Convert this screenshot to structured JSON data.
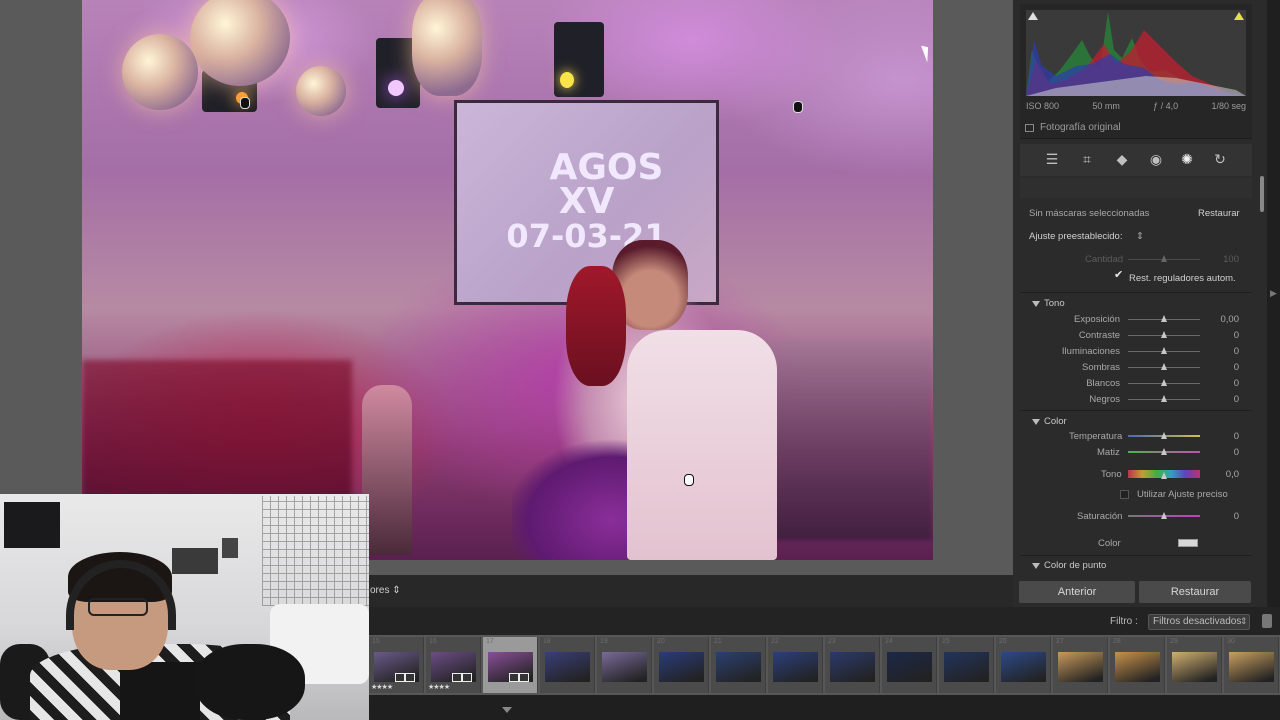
{
  "photo": {
    "projection_lines": [
      "AGOS",
      "XV",
      "07-03-21"
    ]
  },
  "toolbar": {
    "sort_label": "ores ⇕"
  },
  "filmstrip": {
    "filter_label": "Filtro :",
    "filter_value": "Filtros desactivados",
    "cells": [
      {
        "num": "15",
        "stars": "★★★★",
        "thumb": "#6a5a8a",
        "badge": true,
        "selected": false
      },
      {
        "num": "16",
        "stars": "★★★★",
        "thumb": "#6c4d86",
        "badge": true,
        "selected": false
      },
      {
        "num": "17",
        "stars": "",
        "thumb": "#8a4f98",
        "badge": true,
        "selected": true
      },
      {
        "num": "18",
        "stars": "",
        "thumb": "#3a3f78",
        "badge": false,
        "selected": false
      },
      {
        "num": "19",
        "stars": "",
        "thumb": "#7a6a9a",
        "badge": false,
        "selected": false
      },
      {
        "num": "20",
        "stars": "",
        "thumb": "#2a3c7a",
        "badge": false,
        "selected": false
      },
      {
        "num": "21",
        "stars": "",
        "thumb": "#2b4070",
        "badge": false,
        "selected": false
      },
      {
        "num": "22",
        "stars": "",
        "thumb": "#2c3f7c",
        "badge": false,
        "selected": false
      },
      {
        "num": "23",
        "stars": "",
        "thumb": "#2d3a6b",
        "badge": false,
        "selected": false
      },
      {
        "num": "24",
        "stars": "",
        "thumb": "#1d2848",
        "badge": false,
        "selected": false
      },
      {
        "num": "25",
        "stars": "",
        "thumb": "#22345c",
        "badge": false,
        "selected": false
      },
      {
        "num": "26",
        "stars": "",
        "thumb": "#2c4a88",
        "badge": false,
        "selected": false
      },
      {
        "num": "27",
        "stars": "",
        "thumb": "#c89a5a",
        "badge": false,
        "selected": false
      },
      {
        "num": "28",
        "stars": "",
        "thumb": "#c8914a",
        "badge": false,
        "selected": false
      },
      {
        "num": "29",
        "stars": "",
        "thumb": "#d0b070",
        "badge": false,
        "selected": false
      },
      {
        "num": "30",
        "stars": "",
        "thumb": "#c9a060",
        "badge": false,
        "selected": false
      }
    ]
  },
  "histogram": {
    "iso": "ISO 800",
    "focal": "50 mm",
    "aperture": "ƒ / 4,0",
    "shutter": "1/80 seg",
    "original_label": "Fotografía original"
  },
  "panel": {
    "no_masks": "Sin máscaras seleccionadas",
    "reset_link": "Restaurar",
    "preset_label": "Ajuste preestablecido:",
    "preset_arrow": "⇕",
    "amount_label": "Cantidad",
    "amount_value": "100",
    "auto_reset_label": "Rest. reguladores autom.",
    "tone_title": "Tono",
    "tone_sliders": [
      {
        "label": "Exposición",
        "value": "0,00",
        "pos": 0.5
      },
      {
        "label": "Contraste",
        "value": "0",
        "pos": 0.5
      },
      {
        "label": "Iluminaciones",
        "value": "0",
        "pos": 0.5
      },
      {
        "label": "Sombras",
        "value": "0",
        "pos": 0.5
      },
      {
        "label": "Blancos",
        "value": "0",
        "pos": 0.5
      },
      {
        "label": "Negros",
        "value": "0",
        "pos": 0.5
      }
    ],
    "color_title": "Color",
    "temp_label": "Temperatura",
    "temp_value": "0",
    "tint_label": "Matiz",
    "tint_value": "0",
    "hue_label": "Tono",
    "hue_value": "0,0",
    "fine_adjust_label": "Utilizar Ajuste preciso",
    "sat_label": "Saturación",
    "sat_value": "0",
    "color_label": "Color",
    "point_color_title": "Color de punto",
    "btn_prev": "Anterior",
    "btn_reset": "Restaurar"
  },
  "colors": {
    "panel_bg": "#2b2b2b",
    "slider_knob": "#c9c9c9",
    "selected_cell": "#9a9a9a"
  }
}
